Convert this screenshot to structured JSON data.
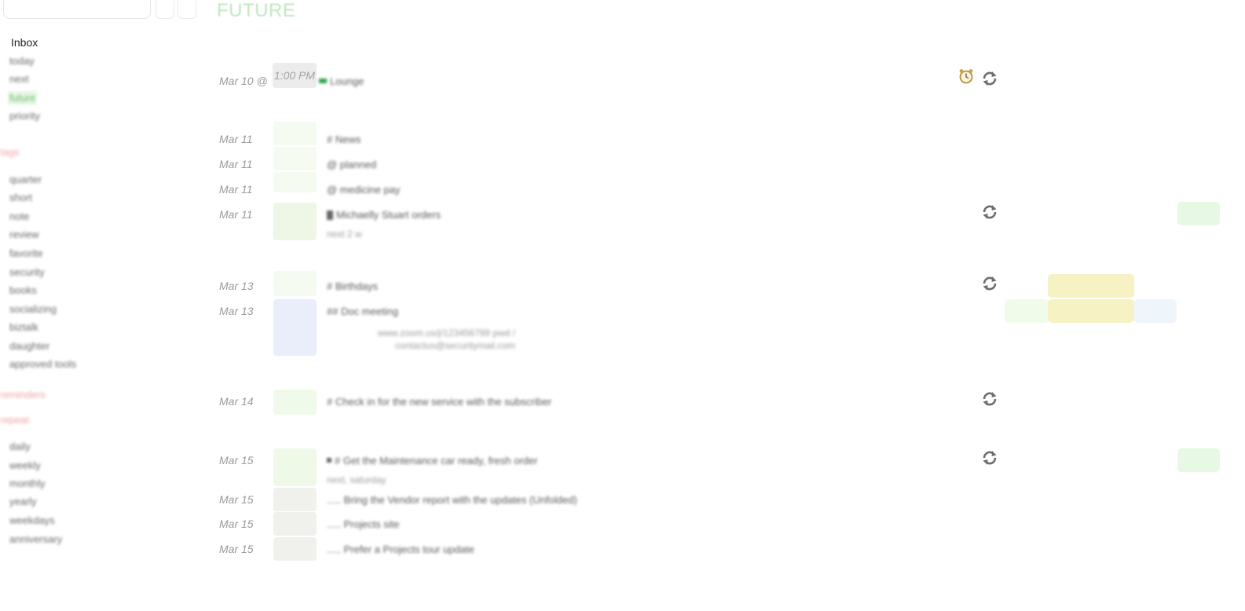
{
  "sidebar": {
    "inbox_label": "Inbox",
    "views": [
      "today",
      "next",
      "future",
      "priority"
    ],
    "active_view": "future",
    "heading_1": "tags",
    "tags": [
      "quarter",
      "short",
      "note",
      "review",
      "favorite",
      "security",
      "books",
      "socializing",
      "biztalk",
      "daughter",
      "approved tools"
    ],
    "heading_2": "reminders",
    "heading_3": "repeat",
    "repeats": [
      "daily",
      "weekly",
      "monthly",
      "yearly",
      "weekdays",
      "anniversary"
    ]
  },
  "main": {
    "title": "FUTURE",
    "rows": [
      {
        "date": "Mar 10 @",
        "time": "1:00 PM",
        "text": "Lounge",
        "sub": "",
        "swatch": "",
        "alarm": true,
        "repeat": true
      },
      {
        "date": "Mar 11",
        "time": "",
        "text": "# News",
        "sub": "",
        "swatch": "#f6fbf1",
        "alarm": false,
        "repeat": false
      },
      {
        "date": "Mar 11",
        "time": "",
        "text": "@ planned",
        "sub": "",
        "swatch": "#f6fbf1",
        "alarm": false,
        "repeat": false
      },
      {
        "date": "Mar 11",
        "time": "",
        "text": "@ medicine pay",
        "sub": "",
        "swatch": "#f6fbf1",
        "alarm": false,
        "repeat": false
      },
      {
        "date": "Mar 11",
        "time": "",
        "text": "Michaelly Stuart orders",
        "sub": "next 2 w",
        "swatch": "#eef7e6",
        "alarm": false,
        "repeat": true
      },
      {
        "date": "Mar 13",
        "time": "",
        "text": "# Birthdays",
        "sub": "",
        "swatch": "#f6fbf1",
        "alarm": false,
        "repeat": true
      },
      {
        "date": "Mar 13",
        "time": "",
        "text": "## Doc meeting",
        "sub": "www.zoom.us/j/123456789 pwd / contactus@securitymail.com",
        "swatch": "#e9eefa",
        "alarm": false,
        "repeat": false
      },
      {
        "date": "Mar 14",
        "time": "",
        "text": "# Check in for the new service with the subscriber",
        "sub": "",
        "swatch": "#effaea",
        "alarm": false,
        "repeat": true
      },
      {
        "date": "Mar 15",
        "time": "",
        "text": "# Get the Maintenance car ready, fresh order",
        "sub": "next, saturday",
        "swatch": "#eef9e8",
        "alarm": false,
        "repeat": true
      },
      {
        "date": "Mar 15",
        "time": "",
        "text": "..... Bring the Vendor report with the updates (Unfolded)",
        "sub": "",
        "swatch": "#f0f0ed",
        "alarm": false,
        "repeat": false
      },
      {
        "date": "Mar 15",
        "time": "",
        "text": "..... Projects site",
        "sub": "",
        "swatch": "#f0f0ed",
        "alarm": false,
        "repeat": false
      },
      {
        "date": "Mar 15",
        "time": "",
        "text": "..... Prefer a Projects tour update",
        "sub": "",
        "swatch": "#f0f0ed",
        "alarm": false,
        "repeat": false
      }
    ]
  },
  "colors": {
    "title": "#bfe7bf",
    "active_nav": "#6cc06c",
    "tag_green": "#e7f9e4",
    "tag_yellow": "#f6f2c4",
    "tag_lightgreen": "#f1fbe9",
    "tag_blue": "#eef5fb"
  }
}
